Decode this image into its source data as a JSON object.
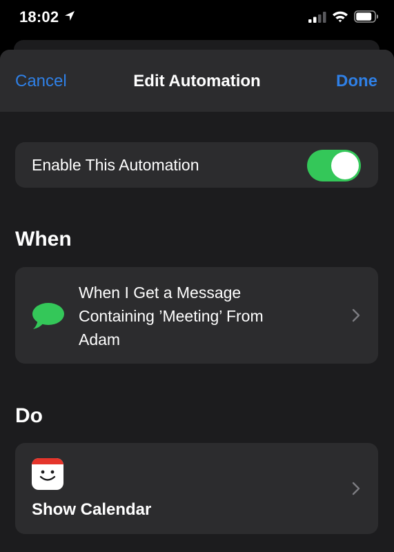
{
  "status_bar": {
    "time": "18:02",
    "icons": [
      "location-arrow-icon",
      "cellular-signal-icon",
      "wifi-icon",
      "battery-icon"
    ]
  },
  "navbar": {
    "cancel_label": "Cancel",
    "title": "Edit Automation",
    "done_label": "Done",
    "accent_color": "#2f80e6"
  },
  "enable_row": {
    "label": "Enable This Automation",
    "toggle_on": true,
    "toggle_color": "#34c759"
  },
  "when_section": {
    "title": "When",
    "trigger_icon": "message-bubble-icon",
    "trigger_lines": [
      "When I Get a Message",
      "Containing ’Meeting’ From",
      "Adam"
    ]
  },
  "do_section": {
    "title": "Do",
    "action_icon": "calendar-icon",
    "action_label": "Show Calendar"
  }
}
